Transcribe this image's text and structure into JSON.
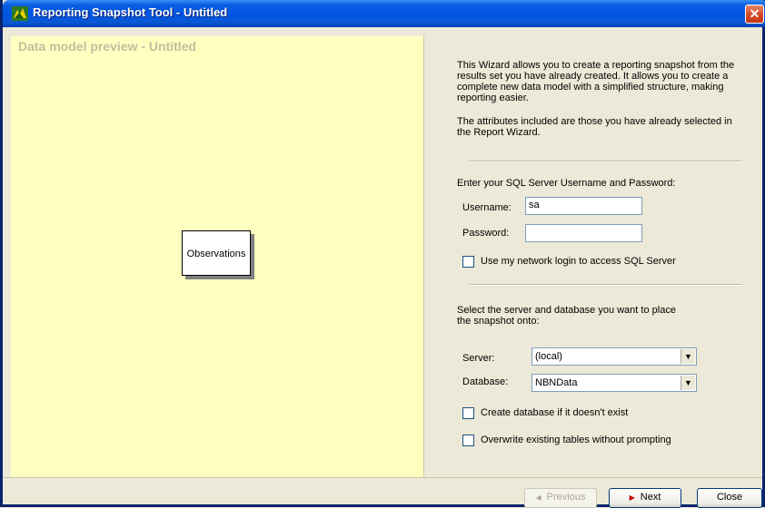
{
  "window": {
    "title": "Reporting Snapshot Tool - Untitled",
    "close_glyph": "✕"
  },
  "preview": {
    "title": "Data model preview - Untitled",
    "entity": "Observations"
  },
  "panel": {
    "intro_1": "This Wizard allows you to create a reporting snapshot from the results set you have already created.  It allows you to create a complete new data model with a simplified structure, making reporting easier.",
    "intro_2": "The attributes included are those you have already selected in the Report Wizard.",
    "credentials_prompt": "Enter your SQL Server Username and Password:",
    "username_label": "Username:",
    "username_value": "sa",
    "password_label": "Password:",
    "password_value": "",
    "network_login_label": "Use my network login to access SQL Server",
    "server_prompt": "Select the server and database you want to place the snapshot onto:",
    "server_label": "Server:",
    "server_value": "(local)",
    "database_label": "Database:",
    "database_value": "NBNData",
    "create_db_label": "Create database if it doesn't exist",
    "overwrite_label": "Overwrite existing tables without prompting"
  },
  "buttons": {
    "previous": "Previous",
    "next": "Next",
    "close": "Close"
  },
  "icons": {
    "app": "reporting-snapshot-app-icon",
    "close": "close-icon",
    "dropdown": "chevron-down-icon",
    "previous": "arrow-left-icon",
    "next": "arrow-right-icon"
  }
}
